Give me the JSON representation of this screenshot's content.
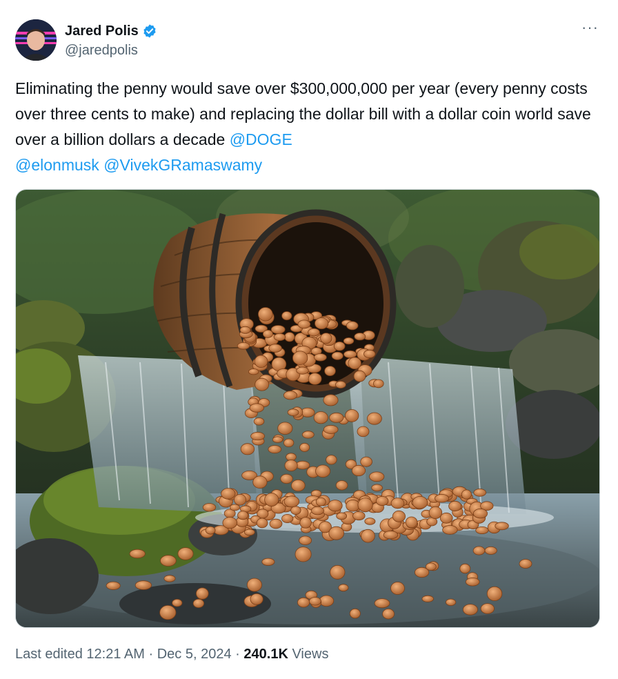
{
  "author": {
    "display_name": "Jared Polis",
    "handle": "@jaredpolis",
    "verified": true,
    "verified_color": "#1d9bf0"
  },
  "more_button": {
    "icon": "more-horizontal-icon",
    "label": "···"
  },
  "tweet": {
    "text_plain": "Eliminating the penny would save over $300,000,000 per year (every penny costs over three cents to make) and replacing the dollar bill with a dollar coin world save over a billion dollars a decade ",
    "mentions": [
      "@DOGE",
      "@elonmusk",
      "@VivekGRamaswamy"
    ]
  },
  "media": {
    "subject": "barrel-spilling-pennies-into-stream",
    "palette": {
      "forest": "#2f4a2a",
      "moss": "#4d6a26",
      "rock": "#3f4240",
      "water": "#9fb3bd",
      "wood": "#8a5a32",
      "hoop": "#2d2a26",
      "copper": "#c47a45"
    }
  },
  "meta": {
    "edited_prefix": "Last edited",
    "time": "12:21 AM",
    "separator": "·",
    "date": "Dec 5, 2024",
    "views_count": "240.1K",
    "views_label": "Views"
  },
  "colors": {
    "text": "#0f1419",
    "secondary": "#536471",
    "link": "#1d9bf0",
    "border": "#cfd9de"
  }
}
